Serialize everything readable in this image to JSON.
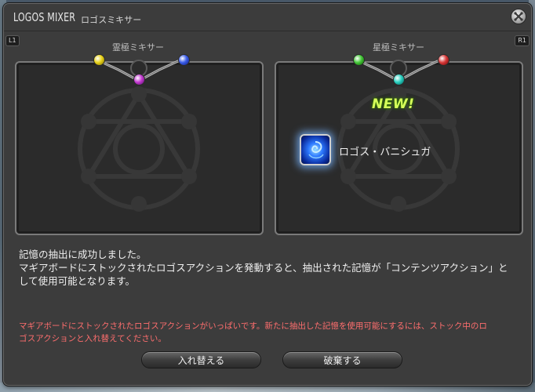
{
  "window": {
    "title": "LOGOS MIXER",
    "subtitle": "ロゴスミキサー",
    "close_icon": "close-icon"
  },
  "controller": {
    "left_tag": "L1",
    "right_tag": "R1"
  },
  "panels": {
    "left": {
      "label": "霊極ミキサー",
      "orb_colors": [
        "#e8d21a",
        "#c33ad0",
        "#3b5de8"
      ]
    },
    "right": {
      "label": "星極ミキサー",
      "orb_colors": [
        "#46c83a",
        "#2ad0c0",
        "#d83a3a"
      ],
      "badge": "NEW!",
      "action": {
        "icon": "logos-action-icon",
        "name": "ロゴス・バニシュガ"
      }
    }
  },
  "message": {
    "lines": [
      "記憶の抽出に成功しました。",
      "マギアボードにストックされたロゴスアクションを発動すると、抽出された記憶が「コンテンツアクション」と",
      "して使用可能となります。"
    ]
  },
  "warning": {
    "lines": [
      "マギアボードにストックされたロゴスアクションがいっぱいです。新たに抽出した記憶を使用可能にするには、ストック中のロ",
      "ゴスアクションと入れ替えてください。"
    ]
  },
  "buttons": {
    "replace": "入れ替える",
    "discard": "破棄する"
  }
}
